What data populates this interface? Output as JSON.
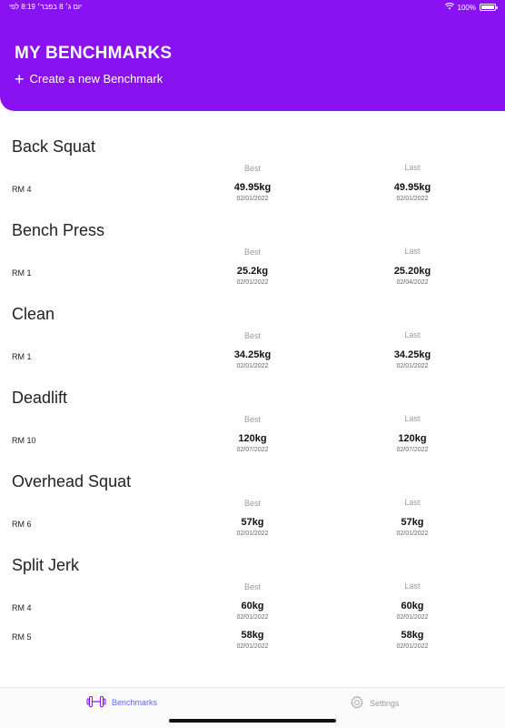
{
  "status": {
    "time_label": "יום ג׳ 8 בפבר׳ 8:19 לפי",
    "wifi": "wifi-icon",
    "battery_label": "100%",
    "battery_level": 1.0
  },
  "header": {
    "title": "MY BENCHMARKS",
    "create_label": "Create a new Benchmark"
  },
  "labels": {
    "best": "Best",
    "last": "Last"
  },
  "benchmarks": [
    {
      "name": "Back Squat",
      "rows": [
        {
          "rm": "RM 4",
          "best": "49.95kg",
          "best_date": "02/01/2022",
          "last": "49.95kg",
          "last_date": "02/01/2022"
        }
      ]
    },
    {
      "name": "Bench Press",
      "rows": [
        {
          "rm": "RM 1",
          "best": "25.2kg",
          "best_date": "02/01/2022",
          "last": "25.20kg",
          "last_date": "02/04/2022"
        }
      ]
    },
    {
      "name": "Clean",
      "rows": [
        {
          "rm": "RM 1",
          "best": "34.25kg",
          "best_date": "02/01/2022",
          "last": "34.25kg",
          "last_date": "02/01/2022"
        }
      ]
    },
    {
      "name": "Deadlift",
      "rows": [
        {
          "rm": "RM 10",
          "best": "120kg",
          "best_date": "02/07/2022",
          "last": "120kg",
          "last_date": "02/07/2022"
        }
      ]
    },
    {
      "name": "Overhead Squat",
      "rows": [
        {
          "rm": "RM 6",
          "best": "57kg",
          "best_date": "02/01/2022",
          "last": "57kg",
          "last_date": "02/01/2022"
        }
      ]
    },
    {
      "name": "Split Jerk",
      "rows": [
        {
          "rm": "RM 4",
          "best": "60kg",
          "best_date": "02/01/2022",
          "last": "60kg",
          "last_date": "02/01/2022"
        },
        {
          "rm": "RM 5",
          "best": "58kg",
          "best_date": "02/01/2022",
          "last": "58kg",
          "last_date": "02/01/2022"
        }
      ]
    }
  ],
  "tabs": [
    {
      "label": "Benchmarks",
      "icon": "dumbbell-icon",
      "active": true
    },
    {
      "label": "Settings",
      "icon": "gear-icon",
      "active": false
    }
  ]
}
